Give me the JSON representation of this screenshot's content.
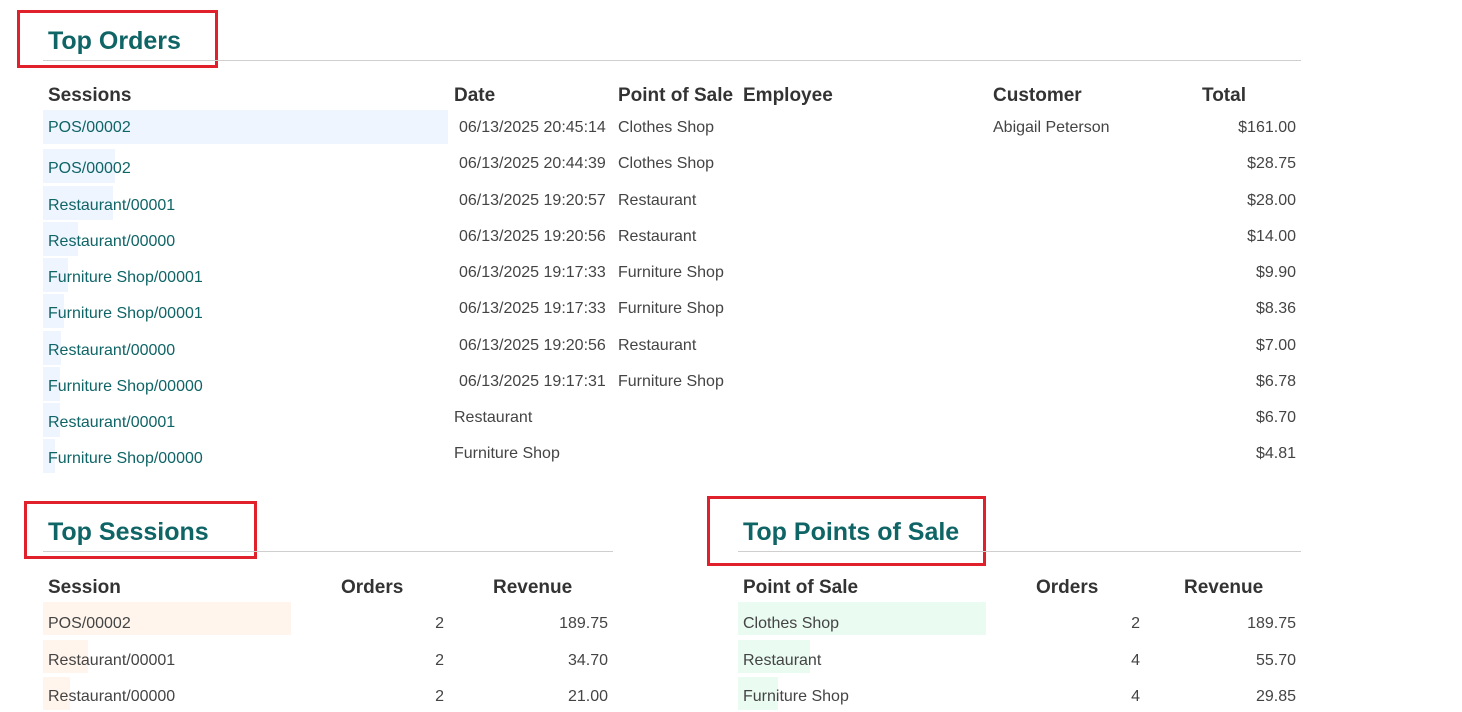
{
  "top_orders": {
    "title": "Top Orders",
    "headers": {
      "sessions": "Sessions",
      "date": "Date",
      "pos": "Point of Sale",
      "employee": "Employee",
      "customer": "Customer",
      "total": "Total"
    },
    "rows": [
      {
        "session": "POS/00002",
        "date": "06/13/2025 20:45:14",
        "pos": "Clothes Shop",
        "employee": "",
        "customer": "Abigail Peterson",
        "total": "$161.00",
        "share": 1.0
      },
      {
        "session": "POS/00002",
        "date": "06/13/2025 20:44:39",
        "pos": "Clothes Shop",
        "employee": "",
        "customer": "",
        "total": "$28.75",
        "share": 0.18
      },
      {
        "session": "Restaurant/00001",
        "date": "06/13/2025 19:20:57",
        "pos": "Restaurant",
        "employee": "",
        "customer": "",
        "total": "$28.00",
        "share": 0.17
      },
      {
        "session": "Restaurant/00000",
        "date": "06/13/2025 19:20:56",
        "pos": "Restaurant",
        "employee": "",
        "customer": "",
        "total": "$14.00",
        "share": 0.087
      },
      {
        "session": "Furniture Shop/00001",
        "date": "06/13/2025 19:17:33",
        "pos": "Furniture Shop",
        "employee": "",
        "customer": "",
        "total": "$9.90",
        "share": 0.061
      },
      {
        "session": "Furniture Shop/00001",
        "date": "06/13/2025 19:17:33",
        "pos": "Furniture Shop",
        "employee": "",
        "customer": "",
        "total": "$8.36",
        "share": 0.052
      },
      {
        "session": "Restaurant/00000",
        "date": "06/13/2025 19:20:56",
        "pos": "Restaurant",
        "employee": "",
        "customer": "",
        "total": "$7.00",
        "share": 0.043
      },
      {
        "session": "Furniture Shop/00000",
        "date": "06/13/2025 19:17:31",
        "pos": "Furniture Shop",
        "employee": "",
        "customer": "",
        "total": "$6.78",
        "share": 0.042
      },
      {
        "session": "Restaurant/00001",
        "date": "",
        "pos": "Restaurant",
        "employee": "",
        "customer": "",
        "total": "$6.70",
        "share": 0.042
      },
      {
        "session": "Furniture Shop/00000",
        "date": "",
        "pos": "Furniture Shop",
        "employee": "",
        "customer": "",
        "total": "$4.81",
        "share": 0.03
      }
    ]
  },
  "top_sessions": {
    "title": "Top Sessions",
    "headers": {
      "session": "Session",
      "orders": "Orders",
      "revenue": "Revenue"
    },
    "rows": [
      {
        "session": "POS/00002",
        "orders": "2",
        "revenue": "189.75",
        "share": 1.0
      },
      {
        "session": "Restaurant/00001",
        "orders": "2",
        "revenue": "34.70",
        "share": 0.18
      },
      {
        "session": "Restaurant/00000",
        "orders": "2",
        "revenue": "21.00",
        "share": 0.11
      }
    ]
  },
  "top_pos": {
    "title": "Top Points of Sale",
    "headers": {
      "pos": "Point of Sale",
      "orders": "Orders",
      "revenue": "Revenue"
    },
    "rows": [
      {
        "pos": "Clothes Shop",
        "orders": "2",
        "revenue": "189.75",
        "share": 1.0
      },
      {
        "pos": "Restaurant",
        "orders": "4",
        "revenue": "55.70",
        "share": 0.29
      },
      {
        "pos": "Furniture Shop",
        "orders": "4",
        "revenue": "29.85",
        "share": 0.16
      }
    ]
  },
  "colors": {
    "title": "#0f6466",
    "link": "#0f6466",
    "highlight_box": "#e0202a",
    "orders_bar": "#eef5ff",
    "sessions_bar": "#fff5ec",
    "pos_bar": "#eafbf2"
  }
}
